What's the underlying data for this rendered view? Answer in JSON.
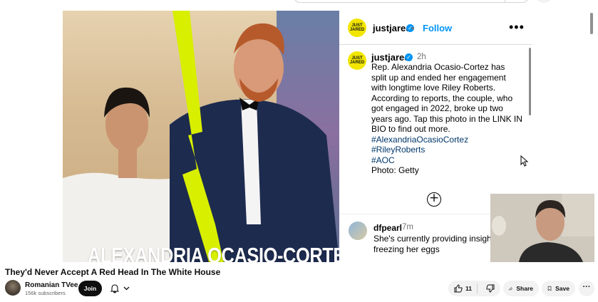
{
  "video": {
    "photo_title": "ALEXANDRIA OCASIO-CORTEZ",
    "instagram": {
      "avatar_text": "JUST JARED",
      "username": "justjared",
      "separator": "•",
      "follow_label": "Follow",
      "more_label": "•••",
      "post_time": "2h",
      "caption": "Rep. Alexandria Ocasio-Cortez has split up and ended her engagement with longtime love Riley Roberts. According to reports, the couple, who got engaged in 2022, broke up two years ago. Tap this photo in the LINK IN BIO to find out more.",
      "hashtags": [
        "#AlexandriaOcasioCortez",
        "#RileyRoberts",
        "#AOC"
      ],
      "photo_credit": "Photo: Getty",
      "add_comment_icon": "plus-circle-icon",
      "comment": {
        "user": "dfpearl",
        "time": "7m",
        "text": "She's currently providing insight freezing her eggs"
      }
    }
  },
  "video_title": "They'd Never Accept A Red Head In The White House",
  "channel": {
    "name": "Romanian TVee",
    "subscribers": "156k subscribers",
    "join_label": "Join"
  },
  "actions": {
    "like_count": "11",
    "share_label": "Share",
    "save_label": "Save"
  },
  "colors": {
    "accent_yellow": "#f2e600",
    "follow_blue": "#0095f6",
    "lightning": "#d8ef00"
  }
}
